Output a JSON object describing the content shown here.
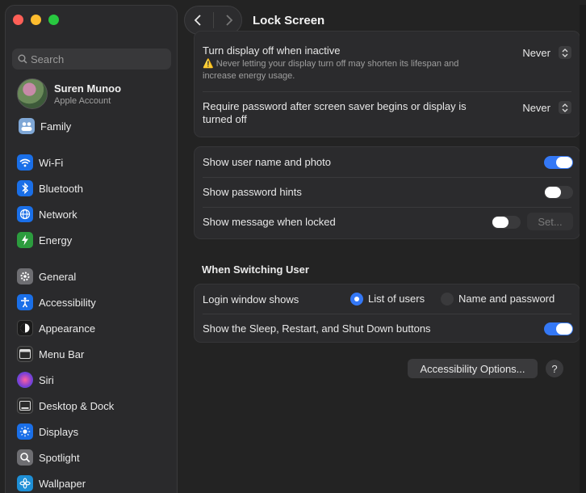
{
  "sidebar": {
    "search_placeholder": "Search",
    "account": {
      "name": "Suren Munoo",
      "subtitle": "Apple Account"
    },
    "family": "Family",
    "items": [
      {
        "label": "Wi-Fi",
        "icon": "wifi-icon",
        "color": "#1a6fe8"
      },
      {
        "label": "Bluetooth",
        "icon": "bluetooth-icon",
        "color": "#1a6fe8"
      },
      {
        "label": "Network",
        "icon": "globe-icon",
        "color": "#1a6fe8"
      },
      {
        "label": "Energy",
        "icon": "bolt-icon",
        "color": "#2c9c3e"
      },
      {
        "label": "General",
        "icon": "gear-icon",
        "color": "#6e6e72"
      },
      {
        "label": "Accessibility",
        "icon": "accessibility-icon",
        "color": "#1a6fe8"
      },
      {
        "label": "Appearance",
        "icon": "appearance-icon",
        "color": "#1b1b1b"
      },
      {
        "label": "Menu Bar",
        "icon": "menubar-icon",
        "color": "#2b2b2b"
      },
      {
        "label": "Siri",
        "icon": "siri-icon",
        "color": "#7a3fd6"
      },
      {
        "label": "Desktop & Dock",
        "icon": "dock-icon",
        "color": "#2b2b2b"
      },
      {
        "label": "Displays",
        "icon": "sun-icon",
        "color": "#1a6fe8"
      },
      {
        "label": "Spotlight",
        "icon": "magnifier-icon",
        "color": "#6e6e72"
      },
      {
        "label": "Wallpaper",
        "icon": "flower-icon",
        "color": "#1e8fd6"
      }
    ]
  },
  "toolbar": {
    "title": "Lock Screen"
  },
  "display": {
    "turn_off_label": "Turn display off when inactive",
    "turn_off_value": "Never",
    "turn_off_hint": "Never letting your display turn off may shorten its lifespan and increase energy usage.",
    "require_pw_label": "Require password after screen saver begins or display is turned off",
    "require_pw_value": "Never"
  },
  "login_options": {
    "show_user_name": {
      "label": "Show user name and photo",
      "on": true
    },
    "show_hints": {
      "label": "Show password hints",
      "on": false
    },
    "show_message": {
      "label": "Show message when locked",
      "on": false,
      "button": "Set..."
    }
  },
  "switching": {
    "title": "When Switching User",
    "login_window_label": "Login window shows",
    "option_list": "List of users",
    "option_name": "Name and password",
    "selected": "List of users",
    "sleep_buttons": {
      "label": "Show the Sleep, Restart, and Shut Down buttons",
      "on": true
    }
  },
  "footer": {
    "accessibility_button": "Accessibility Options...",
    "help": "?"
  }
}
